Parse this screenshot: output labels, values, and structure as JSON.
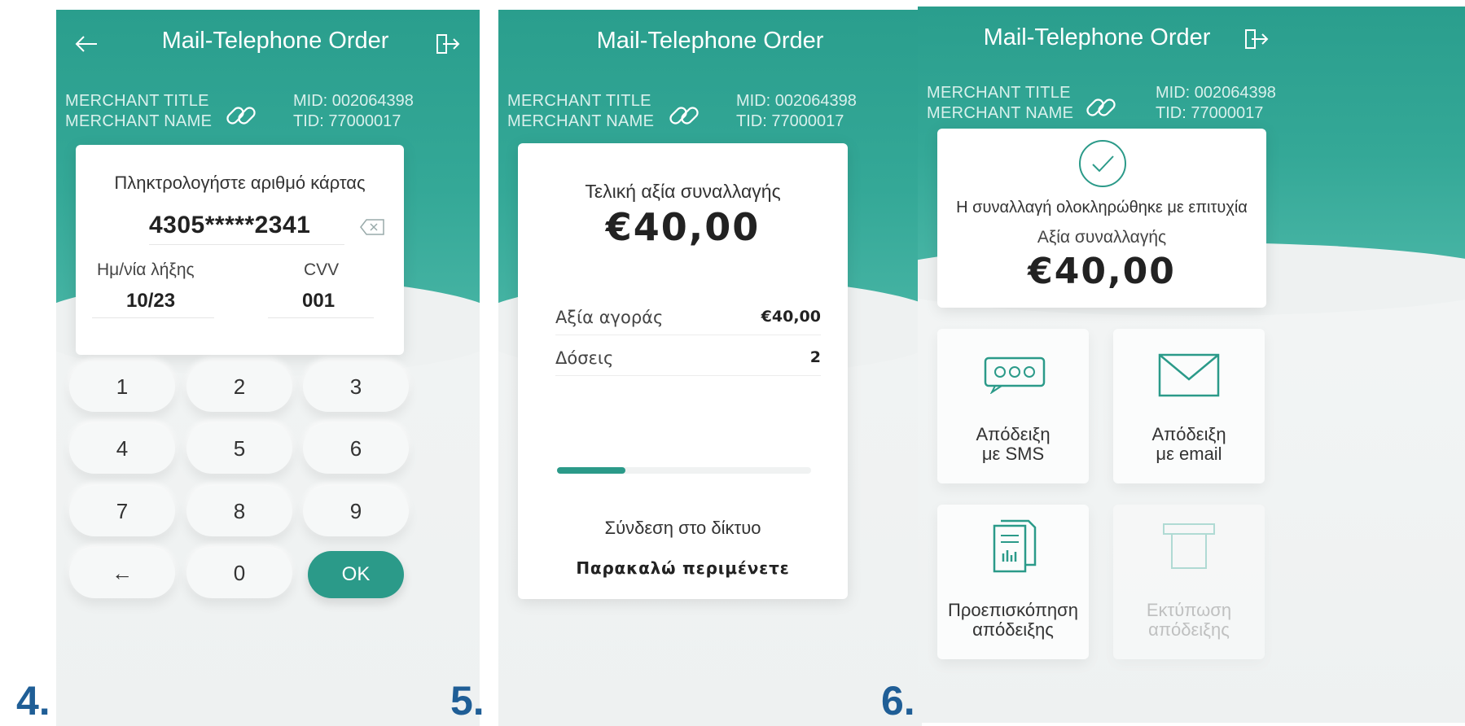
{
  "colors": {
    "accent": "#2b9a89",
    "step_number": "#1f5e96"
  },
  "screens": [
    {
      "step": "4.",
      "title": "Mail-Telephone Order",
      "merchant_title": "MERCHANT TITLE",
      "merchant_name": "MERCHANT NAME",
      "mid": "MID: 002064398",
      "tid": "TID: 77000017",
      "prompt": "Πληκτρολογήστε αριθμό κάρτας",
      "card_number": "4305*****2341",
      "expiry_label": "Ημ/νία λήξης",
      "expiry_value": "10/23",
      "cvv_label": "CVV",
      "cvv_value": "001",
      "keys": [
        "1",
        "2",
        "3",
        "4",
        "5",
        "6",
        "7",
        "8",
        "9",
        "←",
        "0",
        "OK"
      ]
    },
    {
      "step": "5.",
      "title": "Mail-Telephone Order",
      "merchant_title": "MERCHANT TITLE",
      "merchant_name": "MERCHANT NAME",
      "mid": "MID: 002064398",
      "tid": "TID: 77000017",
      "total_label": "Τελική αξία συναλλαγής",
      "total_amount": "€40,00",
      "rows": [
        {
          "label": "Αξία αγοράς",
          "value": "€40,00"
        },
        {
          "label": "Δόσεις",
          "value": "2"
        }
      ],
      "progress": 0.27,
      "status": "Σύνδεση στο δίκτυο",
      "wait": "Παρακαλώ περιμένετε"
    },
    {
      "step": "6.",
      "title": "Mail-Telephone Order",
      "merchant_title": "MERCHANT TITLE",
      "merchant_name": "MERCHANT NAME",
      "mid": "MID: 002064398",
      "tid": "TID: 77000017",
      "success_message": "Η συναλλαγή ολοκληρώθηκε με επιτυχία",
      "amount_label": "Αξία συναλλαγής",
      "amount": "€40,00",
      "tiles": [
        {
          "line1": "Απόδειξη",
          "line2": "με SMS",
          "icon": "sms-icon"
        },
        {
          "line1": "Απόδειξη",
          "line2": "με email",
          "icon": "envelope-icon"
        },
        {
          "line1": "Προεπισκόπηση",
          "line2": "απόδειξης",
          "icon": "receipt-preview-icon"
        },
        {
          "line1": "Εκτύπωση",
          "line2": "απόδειξης",
          "icon": "printer-icon"
        }
      ]
    }
  ]
}
